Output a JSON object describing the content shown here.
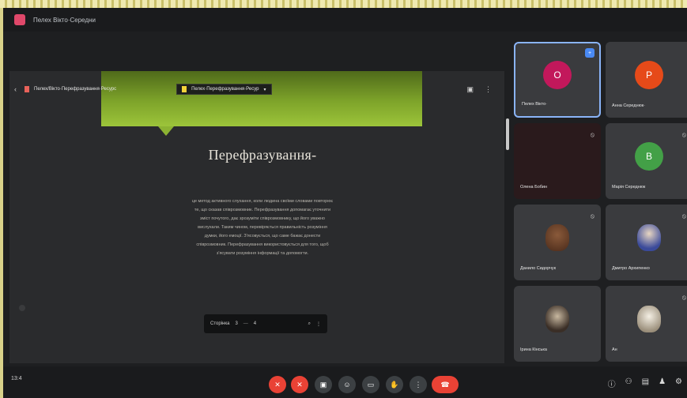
{
  "window": {
    "title": "Пелех Вікто·Середни"
  },
  "presentation": {
    "tabs": [
      {
        "label": "Пелех/Вікто·Перефразування·Ресурс",
        "color": "#e8625a"
      },
      {
        "label": "Пелех·Перефразування·Ресур",
        "color": "#f2d23a"
      }
    ],
    "slide_title": "Перефразування-",
    "slide_lines": [
      "це метод активного слухання, коли людина своїми словами повторює",
      "те, що сказав співрозмовник. Перефразування допомагає уточнити",
      "зміст почутого, дає зрозуміти співрозмовнику, що його уважно",
      "вислухали. Таким чином, перевіряється правильність розуміння",
      "думки, його емоції. З'ясовується, що саме бажає донести",
      "співрозмовник. Перефразування використовується для того, щоб",
      "з'ясувати розуміння інформації та допомогти."
    ],
    "bold_phrase": "Перефразування",
    "page_control": {
      "label": "Сторінка",
      "current": "3",
      "separator": "—",
      "total": "4",
      "zoom_icon": "zoom-icon",
      "more_icon": "more-icon"
    }
  },
  "participants": [
    {
      "name": "Пелех Вікто·",
      "initial": "О",
      "avatar_color": "#c2185b",
      "active": true,
      "has_photo": false
    },
    {
      "name": "Анна Середнюк·",
      "initial": "Р",
      "avatar_color": "#e64a19",
      "active": false,
      "has_photo": false
    },
    {
      "name": "Олена Бобин",
      "initial": "",
      "avatar_color": "#2a1a1c",
      "active": false,
      "has_photo": false
    },
    {
      "name": "Марія Середнюк",
      "initial": "В",
      "avatar_color": "#43a047",
      "active": false,
      "has_photo": false
    },
    {
      "name": "Данило Сидорчук",
      "initial": "",
      "avatar_color": "#5a3a2a",
      "active": false,
      "has_photo": true
    },
    {
      "name": "Дмитро Архипенко",
      "initial": "",
      "avatar_color": "#4a5a8a",
      "active": false,
      "has_photo": true
    },
    {
      "name": "Ірина Кінська",
      "initial": "",
      "avatar_color": "#6a5a4a",
      "active": false,
      "has_photo": true
    },
    {
      "name": "Ан",
      "initial": "",
      "avatar_color": "#d8d2c4",
      "active": false,
      "has_photo": true
    }
  ],
  "bottombar": {
    "time": "13:4",
    "controls": [
      {
        "name": "mic-off-button",
        "glyph": "✕",
        "style": "red"
      },
      {
        "name": "camera-off-button",
        "glyph": "✕",
        "style": "red"
      },
      {
        "name": "captions-button",
        "glyph": "▣",
        "style": "dark"
      },
      {
        "name": "emoji-button",
        "glyph": "☺",
        "style": "dark"
      },
      {
        "name": "present-button",
        "glyph": "▭",
        "style": "dark"
      },
      {
        "name": "raise-hand-button",
        "glyph": "✋",
        "style": "dark"
      },
      {
        "name": "more-options-button",
        "glyph": "⋮",
        "style": "dark"
      },
      {
        "name": "leave-call-button",
        "glyph": "☎",
        "style": "hang"
      }
    ],
    "right_icons": [
      "info-icon",
      "people-icon",
      "chat-icon",
      "activities-icon",
      "host-controls-icon"
    ]
  }
}
